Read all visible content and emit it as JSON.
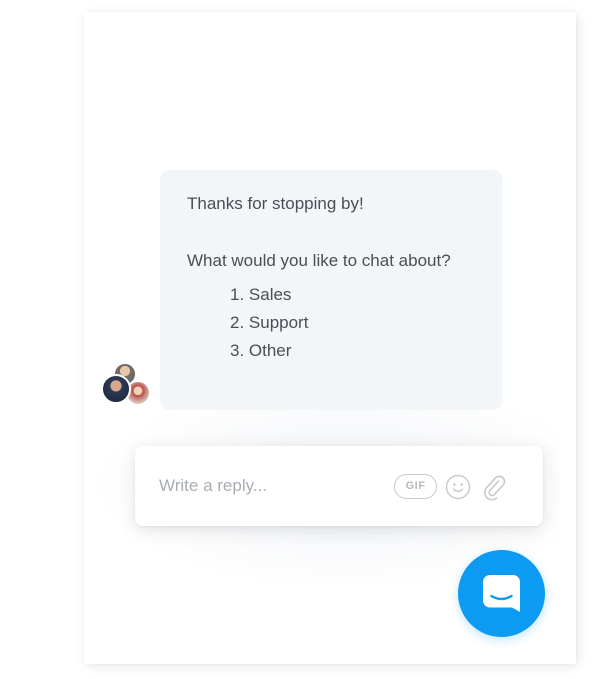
{
  "message": {
    "greeting": "Thanks for stopping by!",
    "question": "What would you like to chat about?",
    "options": [
      "1. Sales",
      "2. Support",
      "3. Other"
    ]
  },
  "composer": {
    "placeholder": "Write a reply...",
    "gif_label": "GIF"
  },
  "icons": {
    "emoji": "smiley-icon",
    "attach": "paperclip-icon",
    "launcher": "chat-bubble-icon"
  },
  "colors": {
    "accent": "#0c9af2",
    "bubble_bg": "#f3f6f9",
    "text": "#4a4f55",
    "placeholder": "#a8adb3"
  }
}
